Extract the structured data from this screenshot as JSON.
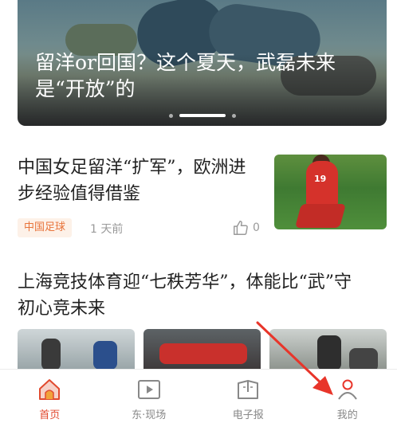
{
  "hero": {
    "title": "留洋or回国？这个夏天，武磊未来是“开放”的"
  },
  "articles": [
    {
      "title": "中国女足留洋“扩军”，欧洲进步经验值得借鉴",
      "tag": "中国足球",
      "time": "1 天前",
      "likes": "0",
      "jersey_number": "19"
    },
    {
      "title": "上海竞技体育迎“七秩芳华”，体能比“武”守初心竞未来"
    }
  ],
  "nav": {
    "items": [
      {
        "label": "首页",
        "icon": "home-icon",
        "active": true
      },
      {
        "label": "东·现场",
        "icon": "video-play-icon",
        "active": false
      },
      {
        "label": "电子报",
        "icon": "newspaper-icon",
        "active": false
      },
      {
        "label": "我的",
        "icon": "user-icon",
        "active": false
      }
    ]
  },
  "colors": {
    "accent": "#e14a2f",
    "tag_bg": "#fdf1e8",
    "tag_text": "#e8743b",
    "annotation_arrow": "#e8352a"
  }
}
